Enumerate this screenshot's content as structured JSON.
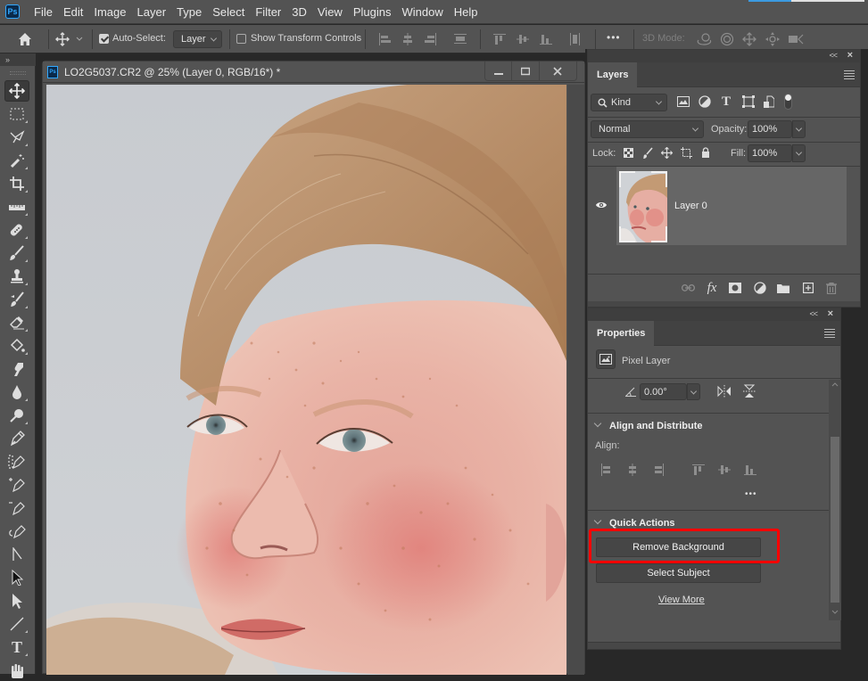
{
  "app": {
    "logo_text": "Ps",
    "menu": [
      "File",
      "Edit",
      "Image",
      "Layer",
      "Type",
      "Select",
      "Filter",
      "3D",
      "View",
      "Plugins",
      "Window",
      "Help"
    ]
  },
  "options_bar": {
    "auto_select_label": "Auto-Select:",
    "auto_select_checked": true,
    "auto_select_target": "Layer",
    "show_transform_label": "Show Transform Controls",
    "show_transform_checked": false,
    "more_label": "•••",
    "mode_3d_label": "3D Mode:"
  },
  "toolbar": {
    "collapse_label": "»",
    "tools": [
      {
        "name": "move-tool",
        "active": true
      },
      {
        "name": "rectangular-marquee-tool"
      },
      {
        "name": "lasso-tool"
      },
      {
        "name": "magic-wand-tool"
      },
      {
        "name": "crop-tool"
      },
      {
        "name": "ruler-tool"
      },
      {
        "name": "healing-brush-tool"
      },
      {
        "name": "brush-tool"
      },
      {
        "name": "clone-stamp-tool"
      },
      {
        "name": "history-brush-tool"
      },
      {
        "name": "eraser-tool"
      },
      {
        "name": "paint-bucket-tool"
      },
      {
        "name": "smudge-tool"
      },
      {
        "name": "blur-tool"
      },
      {
        "name": "dodge-tool"
      },
      {
        "name": "pen-tool"
      },
      {
        "name": "curvature-pen-tool"
      },
      {
        "name": "add-anchor-point-tool"
      },
      {
        "name": "delete-anchor-point-tool"
      },
      {
        "name": "convert-point-tool"
      },
      {
        "name": "freeform-line-tool"
      },
      {
        "name": "path-selection-tool"
      },
      {
        "name": "direct-selection-tool"
      },
      {
        "name": "line-tool"
      },
      {
        "name": "type-tool"
      },
      {
        "name": "hand-tool"
      }
    ],
    "type_glyph": "T"
  },
  "document": {
    "title": "LO2G5037.CR2 @ 25% (Layer 0, RGB/16*) *",
    "icon_text": "Ps",
    "zoom": "25%"
  },
  "layers_panel": {
    "tab": "Layers",
    "filter_kind": "Kind",
    "blend_mode": "Normal",
    "opacity_label": "Opacity:",
    "opacity": "100%",
    "lock_label": "Lock:",
    "fill_label": "Fill:",
    "fill": "100%",
    "layers": [
      {
        "name": "Layer 0",
        "visible": true
      }
    ],
    "fx_label": "fx"
  },
  "properties_panel": {
    "tab": "Properties",
    "layer_type": "Pixel Layer",
    "angle": "0.00°",
    "align_section": "Align and Distribute",
    "align_label": "Align:",
    "more_label": "•••",
    "quick_actions_section": "Quick Actions",
    "remove_background": "Remove Background",
    "select_subject": "Select Subject",
    "view_more": "View More"
  },
  "colors": {
    "ui_panel": "#535353",
    "ui_dark": "#282828",
    "accent_blue": "#31a8ff",
    "highlight_red": "#ff0000"
  }
}
